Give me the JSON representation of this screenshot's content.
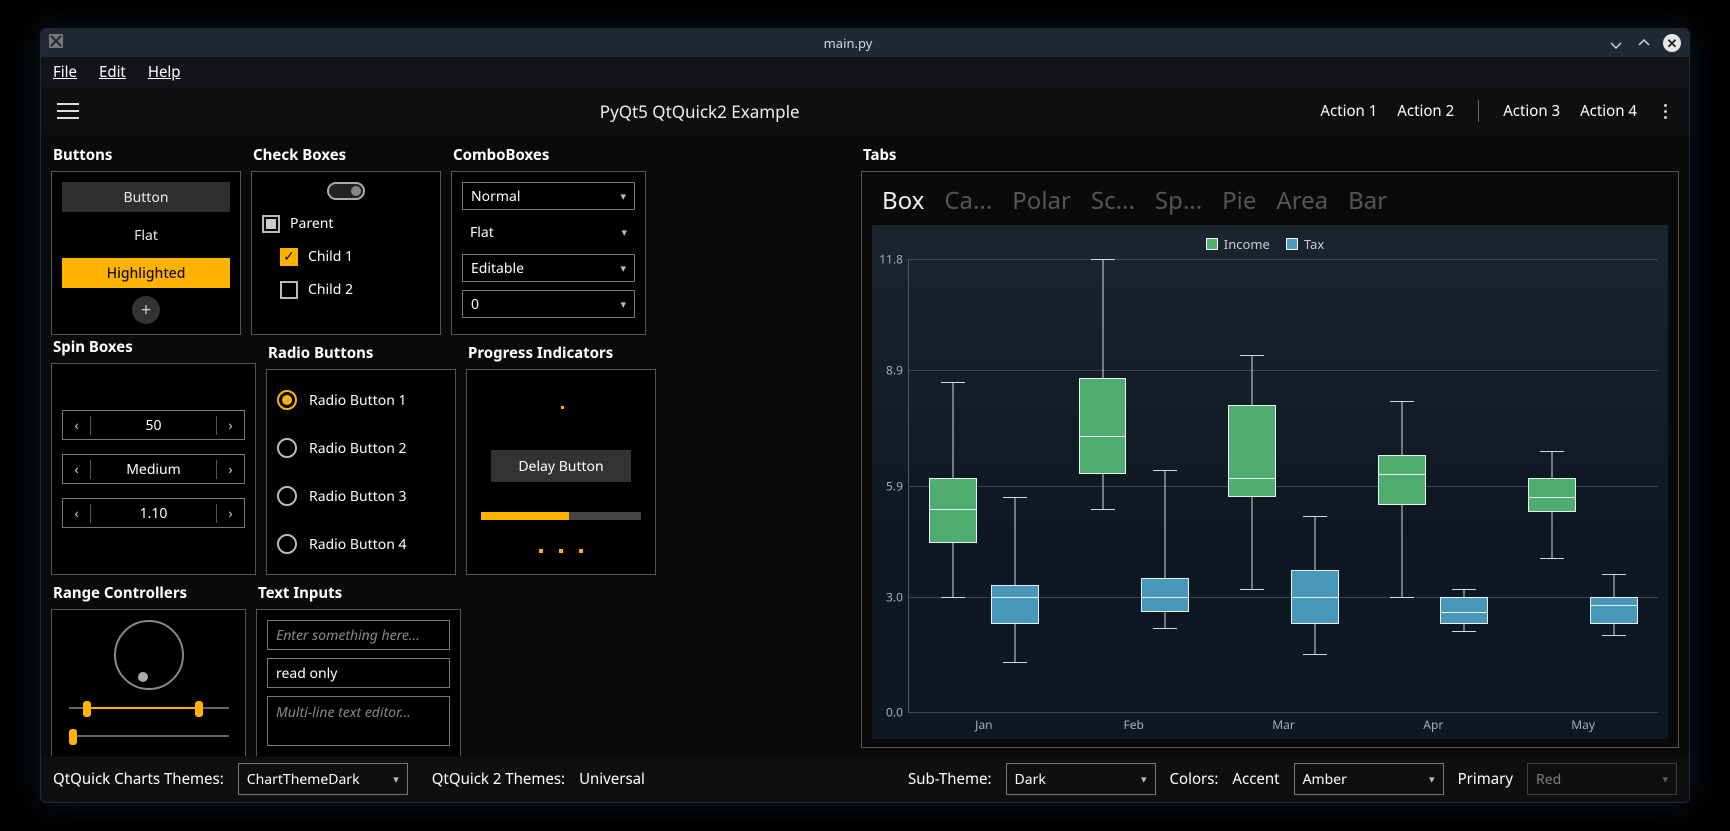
{
  "window": {
    "title": "main.py"
  },
  "menu": {
    "file": "File",
    "edit": "Edit",
    "help": "Help"
  },
  "toolbar": {
    "title": "PyQt5 QtQuick2 Example",
    "a1": "Action 1",
    "a2": "Action 2",
    "a3": "Action 3",
    "a4": "Action 4"
  },
  "sections": {
    "buttons": "Buttons",
    "checks": "Check Boxes",
    "combos": "ComboBoxes",
    "spins": "Spin Boxes",
    "tabs": "Tabs",
    "radios": "Radio Buttons",
    "progress": "Progress Indicators",
    "range": "Range Controllers",
    "text": "Text Inputs"
  },
  "buttons": {
    "b1": "Button",
    "b2": "Flat",
    "b3": "Highlighted",
    "round": "+"
  },
  "checks": {
    "parent": "Parent",
    "c1": "Child 1",
    "c2": "Child 2"
  },
  "combos": {
    "c1": "Normal",
    "c2": "Flat",
    "c3": "Editable",
    "c4": "0"
  },
  "spins": {
    "s1": "50",
    "s2": "Medium",
    "s3": "1.10"
  },
  "radios": {
    "r1": "Radio Button 1",
    "r2": "Radio Button 2",
    "r3": "Radio Button 3",
    "r4": "Radio Button 4"
  },
  "progress": {
    "delay": "Delay Button"
  },
  "text": {
    "ph": "Enter something here...",
    "ro": "read only",
    "ml": "Multi-line text editor..."
  },
  "tabs": {
    "items": [
      "Box",
      "Ca...",
      "Polar",
      "Sc...",
      "Sp...",
      "Pie",
      "Area",
      "Bar"
    ],
    "active": 0
  },
  "legend": {
    "s1": "Income",
    "s2": "Tax"
  },
  "chart_data": {
    "type": "boxplot",
    "categories": [
      "Jan",
      "Feb",
      "Mar",
      "Apr",
      "May"
    ],
    "ylabel": "",
    "ylim": [
      0,
      11.8
    ],
    "yticks": [
      0.0,
      3.0,
      5.9,
      8.9,
      11.8
    ],
    "series": [
      {
        "name": "Income",
        "color": "#4fae6f",
        "values": [
          {
            "min": 3.0,
            "q1": 4.4,
            "median": 5.3,
            "q3": 6.1,
            "max": 8.6
          },
          {
            "min": 5.3,
            "q1": 6.2,
            "median": 7.2,
            "q3": 8.7,
            "max": 11.8
          },
          {
            "min": 3.2,
            "q1": 5.6,
            "median": 6.1,
            "q3": 8.0,
            "max": 9.3
          },
          {
            "min": 3.0,
            "q1": 5.4,
            "median": 6.2,
            "q3": 6.7,
            "max": 8.1
          },
          {
            "min": 4.0,
            "q1": 5.2,
            "median": 5.6,
            "q3": 6.1,
            "max": 6.8
          }
        ]
      },
      {
        "name": "Tax",
        "color": "#4898bc",
        "values": [
          {
            "min": 1.3,
            "q1": 2.3,
            "median": 3.0,
            "q3": 3.3,
            "max": 5.6
          },
          {
            "min": 2.2,
            "q1": 2.6,
            "median": 3.0,
            "q3": 3.5,
            "max": 6.3
          },
          {
            "min": 1.5,
            "q1": 2.3,
            "median": 3.0,
            "q3": 3.7,
            "max": 5.1
          },
          {
            "min": 2.1,
            "q1": 2.3,
            "median": 2.6,
            "q3": 3.0,
            "max": 3.2
          },
          {
            "min": 2.0,
            "q1": 2.3,
            "median": 2.8,
            "q3": 3.0,
            "max": 3.6
          }
        ]
      }
    ]
  },
  "footer": {
    "l1": "QtQuick Charts Themes:",
    "v1": "ChartThemeDark",
    "l2": "QtQuick 2 Themes:",
    "v2": "Universal",
    "l3": "Sub-Theme:",
    "v3": "Dark",
    "l4": "Colors:",
    "accentL": "Accent",
    "accentV": "Amber",
    "primaryL": "Primary",
    "primaryV": "Red"
  }
}
